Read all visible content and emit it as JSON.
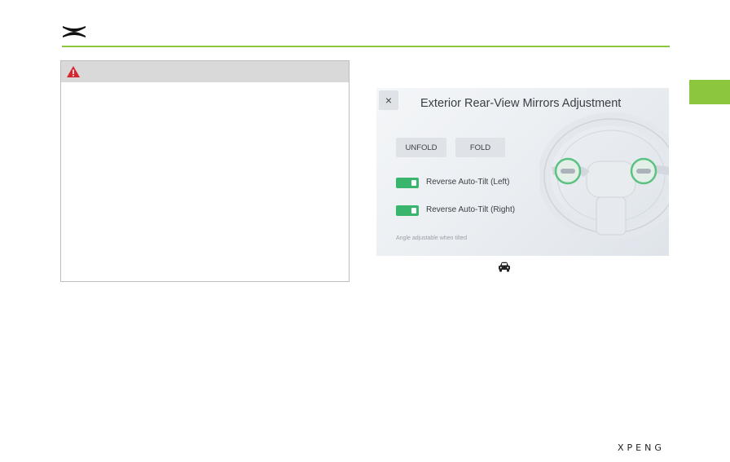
{
  "screen": {
    "close_label": "×",
    "title": "Exterior Rear-View Mirrors Adjustment",
    "unfold_label": "UNFOLD",
    "fold_label": "FOLD",
    "toggles": [
      {
        "label": "Reverse Auto-Tilt (Left)",
        "on": true
      },
      {
        "label": "Reverse Auto-Tilt (Right)",
        "on": true
      }
    ],
    "hint": "Angle adjustable when tilted"
  },
  "colors": {
    "accent": "#8cc63f",
    "toggle_on": "#3ab56e",
    "warning": "#d7262f"
  },
  "icons": {
    "header": "xpeng-logo-icon",
    "warning": "warning-triangle-icon",
    "caption": "car-icon"
  },
  "footer": {
    "brand": "XPENG"
  }
}
